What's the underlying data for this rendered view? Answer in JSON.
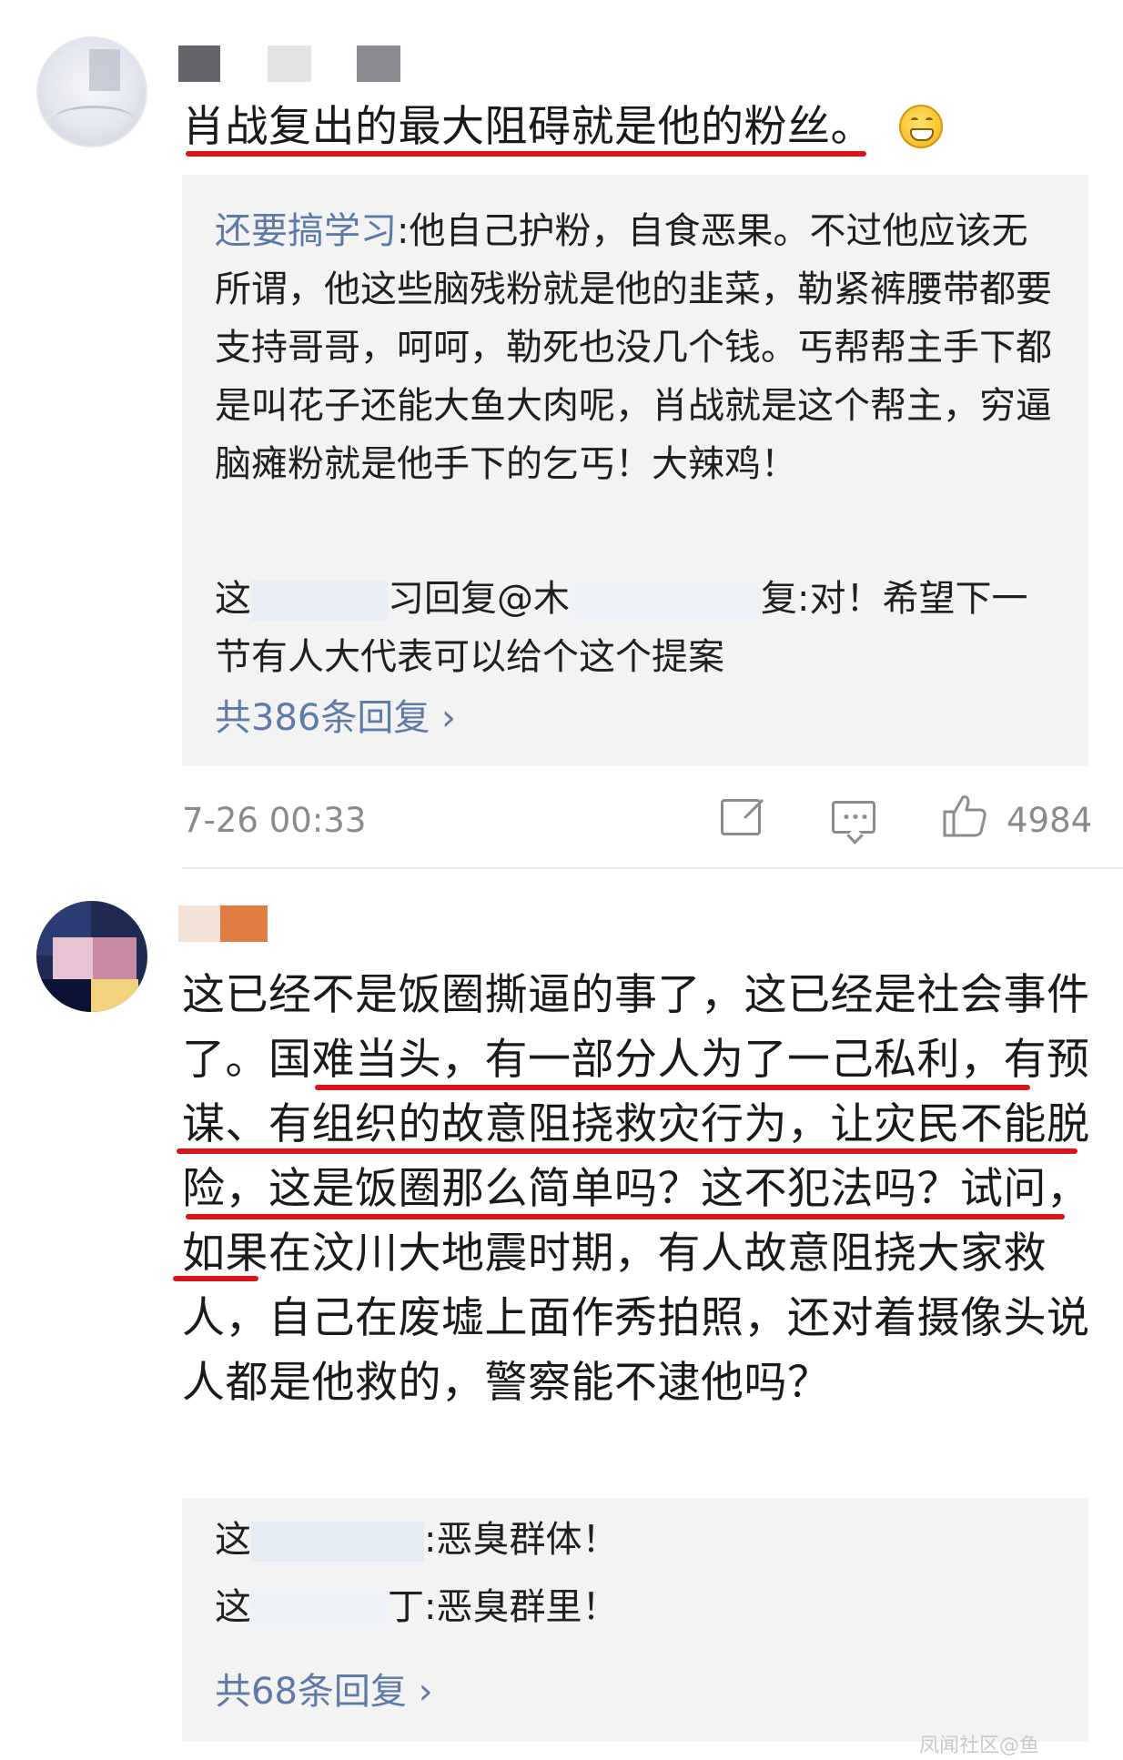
{
  "comments": [
    {
      "text": "肖战复出的最大阻碍就是他的粉丝。",
      "replies": [
        {
          "name": "还要搞学习",
          "text": ":他自己护粉，自食恶果。不过他应该无所谓，他这些脑残粉就是他的韭菜，勒紧裤腰带都要支持哥哥，呵呵，勒死也没几个钱。丐帮帮主手下都是叫花子还能大鱼大肉呢，肖战就是这个帮主，穷逼脑瘫粉就是他手下的乞丐！大辣鸡！"
        },
        {
          "name_prefix": "这",
          "mid_a": "习回复@",
          "mid_b": "木",
          "mid_c": "复",
          "text": ":对！希望下一节有人大代表可以给个这个提案"
        }
      ],
      "more_replies": "共386条回复 ›",
      "time": "7-26 00:33",
      "likes": "4984"
    },
    {
      "text": "这已经不是饭圈撕逼的事了，这已经是社会事件了。国难当头，有一部分人为了一己私利，有预谋、有组织的故意阻挠救灾行为，让灾民不能脱险，这是饭圈那么简单吗？这不犯法吗？试问，如果在汶川大地震时期，有人故意阻挠大家救人，自己在废墟上面作秀拍照，还对着摄像头说人都是他救的，警察能不逮他吗？",
      "replies": [
        {
          "name_prefix": "这",
          "text": ":恶臭群体！"
        },
        {
          "name_prefix": "这",
          "suffix": "丁",
          "text": ":恶臭群里！"
        }
      ],
      "more_replies": "共68条回复 ›"
    }
  ],
  "watermark": "凤闻社区@鱼"
}
